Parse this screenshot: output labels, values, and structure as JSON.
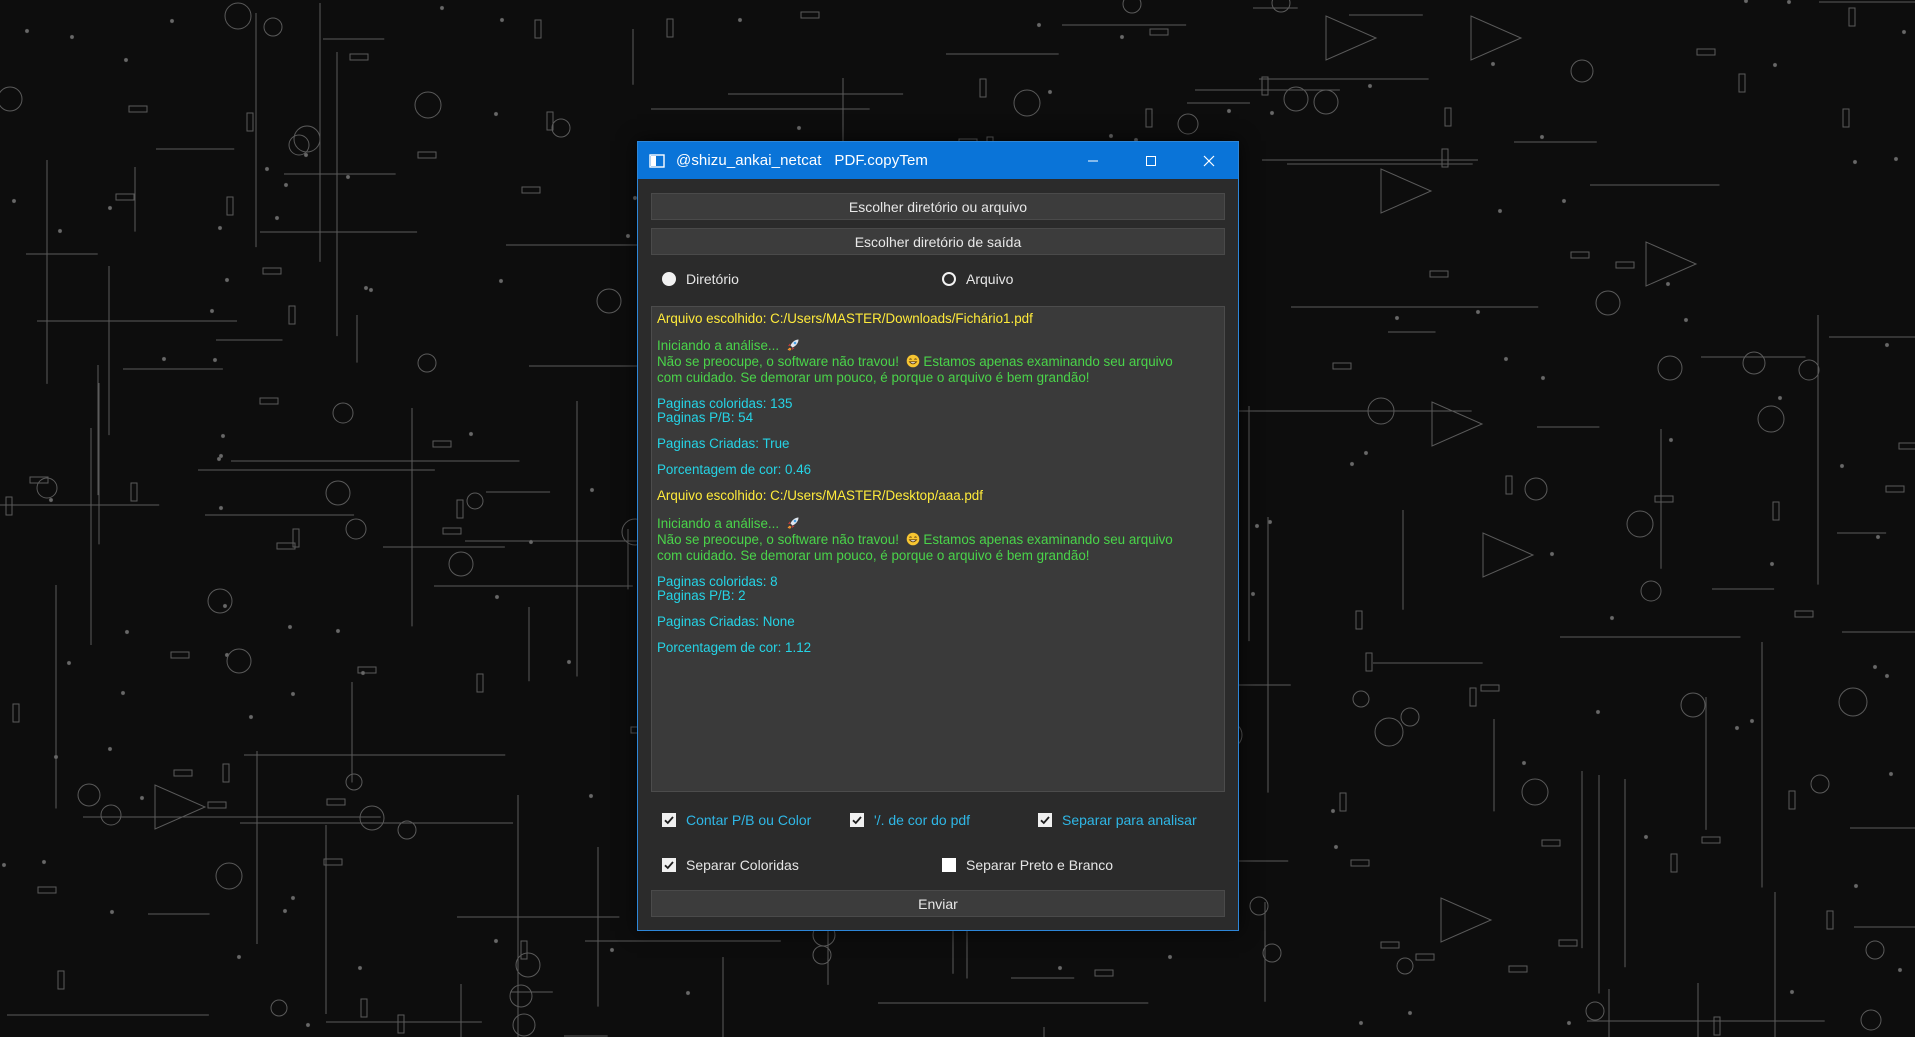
{
  "window": {
    "title": "@shizu_ankai_netcat   PDF.copyTem",
    "icon": "window-app-icon",
    "controls": [
      "minimize-icon",
      "maximize-icon",
      "close-icon"
    ],
    "accent_color": "#0a74d8"
  },
  "buttons": {
    "choose_input": "Escolher diretório ou arquivo",
    "choose_output": "Escolher diretório de saída",
    "submit": "Enviar"
  },
  "mode": {
    "options": [
      {
        "label": "Diretório",
        "selected": true
      },
      {
        "label": "Arquivo",
        "selected": false
      }
    ]
  },
  "log": {
    "lines": [
      {
        "text": "Arquivo escolhido: C:/Users/MASTER/Downloads/Fichário1.pdf",
        "color": "#ffeb3b"
      },
      {
        "text": "Iniciando a análise...",
        "color": "#4ad44a",
        "emoji": "rocket"
      },
      {
        "text": "Não se preocupe, o software não travou!",
        "color": "#4ad44a"
      },
      {
        "text": "Estamos apenas examinando seu arquivo",
        "color": "#4ad44a",
        "emoji_before": "grin"
      },
      {
        "text": "com cuidado. Se demorar um pouco, é porque o arquivo é bem grandão!",
        "color": "#4ad44a"
      },
      {
        "text": "Paginas coloridas: 135",
        "color": "#25d4e6"
      },
      {
        "text": "Paginas P/B: 54",
        "color": "#25d4e6"
      },
      {
        "text": "Paginas Criadas: True",
        "color": "#25d4e6"
      },
      {
        "text": "Porcentagem de cor: 0.46",
        "color": "#25d4e6"
      },
      {
        "text": "Arquivo escolhido: C:/Users/MASTER/Desktop/aaa.pdf",
        "color": "#ffeb3b"
      },
      {
        "text": "Iniciando a análise...",
        "color": "#4ad44a",
        "emoji": "rocket"
      },
      {
        "text": "Não se preocupe, o software não travou!",
        "color": "#4ad44a"
      },
      {
        "text": "Estamos apenas examinando seu arquivo",
        "color": "#4ad44a",
        "emoji_before": "grin"
      },
      {
        "text": "com cuidado. Se demorar um pouco, é porque o arquivo é bem grandão!",
        "color": "#4ad44a"
      },
      {
        "text": "Paginas coloridas: 8",
        "color": "#25d4e6"
      },
      {
        "text": "Paginas P/B: 2",
        "color": "#25d4e6"
      },
      {
        "text": "Paginas Criadas: None",
        "color": "#25d4e6"
      },
      {
        "text": "Porcentagem de cor: 1.12",
        "color": "#25d4e6"
      }
    ]
  },
  "options": {
    "count_bw_color": {
      "label": "Contar P/B ou Color",
      "checked": true
    },
    "percent_color": {
      "label": "'/. de cor do pdf",
      "checked": true
    },
    "split_to_analyze": {
      "label": "Separar para analisar",
      "checked": true
    },
    "separate_colored": {
      "label": "Separar Coloridas",
      "checked": true
    },
    "separate_bw": {
      "label": "Separar Preto e Branco",
      "checked": false
    }
  },
  "colors": {
    "window_bg": "#2b2b2b",
    "log_bg": "#3a3a3a",
    "yellow_text": "#ffeb3b",
    "green_text": "#4ad44a",
    "cyan_text": "#25d4e6"
  }
}
